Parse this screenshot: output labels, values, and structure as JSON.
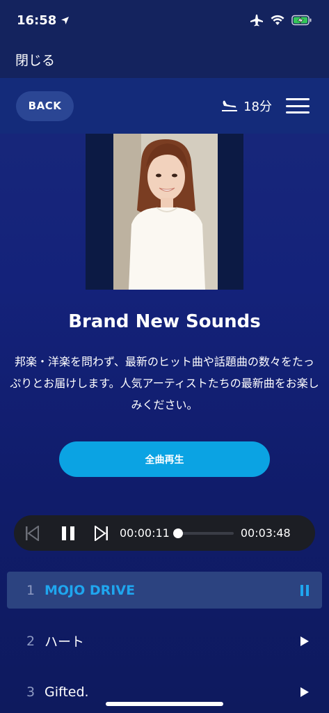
{
  "status_bar": {
    "time": "16:58"
  },
  "close_label": "閉じる",
  "header": {
    "back_label": "BACK",
    "flight_remaining": "18分"
  },
  "playlist": {
    "title": "Brand New Sounds",
    "description": "邦楽・洋楽を問わず、最新のヒット曲や話題曲の数々をたっぷりとお届けします。人気アーティストたちの最新曲をお楽しみください。",
    "play_all_label": "全曲再生"
  },
  "player": {
    "elapsed": "00:00:11",
    "duration": "00:03:48",
    "progress": 0.048
  },
  "tracks": [
    {
      "number": "1",
      "title": "MOJO DRIVE",
      "state": "playing"
    },
    {
      "number": "2",
      "title": "ハート",
      "state": "idle"
    },
    {
      "number": "3",
      "title": "Gifted.",
      "state": "idle"
    }
  ],
  "colors": {
    "accent": "#0ba3e3",
    "active_track_text": "#1fa6ef",
    "background": "#14227a"
  }
}
